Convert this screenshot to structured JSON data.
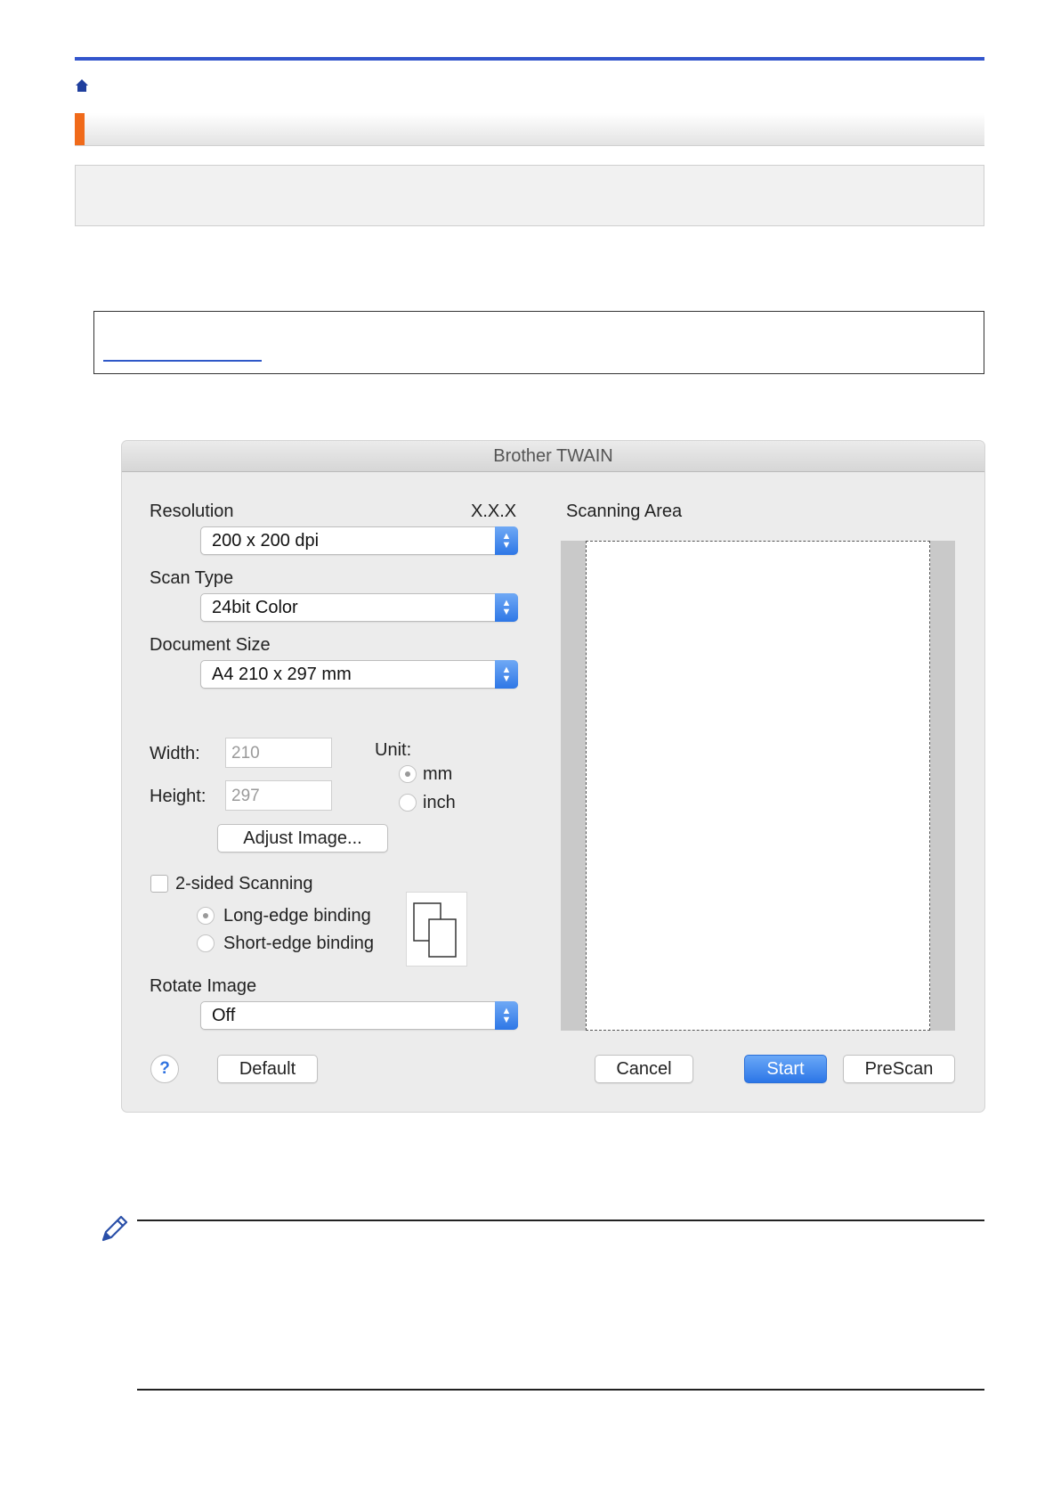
{
  "dialog": {
    "title": "Brother TWAIN",
    "version": "X.X.X",
    "resolution": {
      "label": "Resolution",
      "value": "200 x 200 dpi"
    },
    "scan_type": {
      "label": "Scan Type",
      "value": "24bit Color"
    },
    "document_size": {
      "label": "Document Size",
      "value": "A4  210 x 297 mm"
    },
    "width": {
      "label": "Width:",
      "value": "210"
    },
    "height": {
      "label": "Height:",
      "value": "297"
    },
    "unit": {
      "label": "Unit:",
      "options": [
        "mm",
        "inch"
      ],
      "selected": "mm"
    },
    "adjust_image_label": "Adjust Image...",
    "two_sided": {
      "label": "2-sided Scanning",
      "checked": false
    },
    "binding": {
      "options": [
        "Long-edge binding",
        "Short-edge binding"
      ],
      "selected": "Long-edge binding"
    },
    "rotate_image": {
      "label": "Rotate Image",
      "value": "Off"
    },
    "scanning_area_label": "Scanning Area",
    "buttons": {
      "help": "?",
      "default": "Default",
      "cancel": "Cancel",
      "start": "Start",
      "prescan": "PreScan"
    }
  },
  "colors": {
    "accent_orange": "#f06a1a",
    "top_rule": "#3355cc",
    "primary_button": "#2c76e7"
  },
  "icons": [
    "home-icon",
    "note-pencil-icon",
    "duplex-pages-icon",
    "stepper-icon"
  ]
}
